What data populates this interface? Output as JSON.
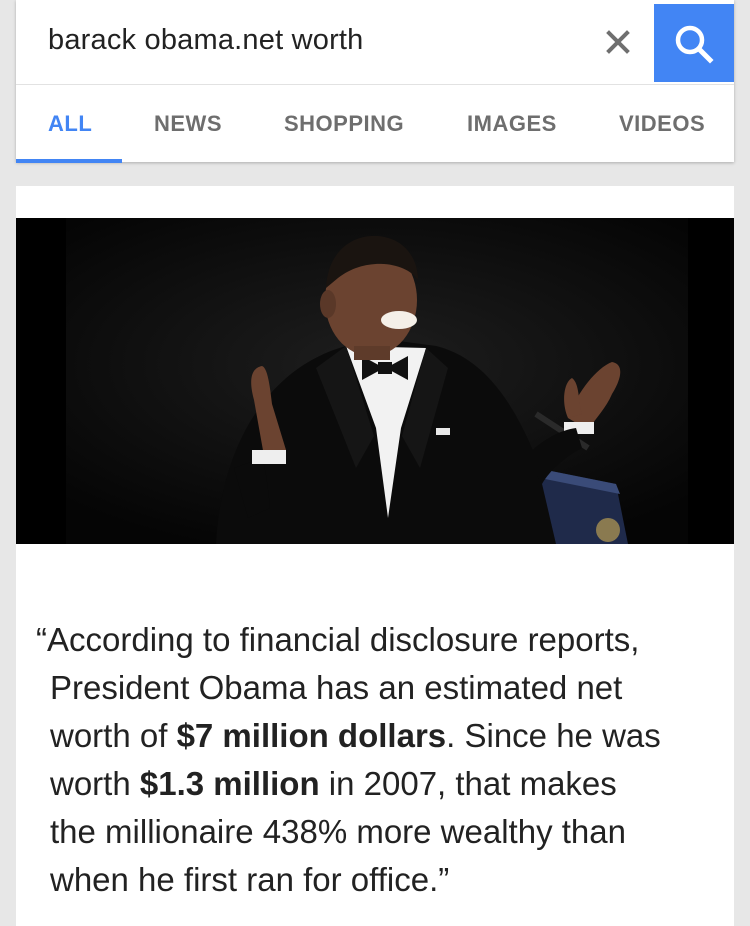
{
  "search": {
    "query": "barack obama.net worth",
    "clear_icon": "close-icon",
    "search_icon": "search-icon",
    "accent_color": "#4285f4"
  },
  "tabs": [
    {
      "label": "ALL",
      "active": true
    },
    {
      "label": "NEWS",
      "active": false
    },
    {
      "label": "SHOPPING",
      "active": false
    },
    {
      "label": "IMAGES",
      "active": false
    },
    {
      "label": "VIDEOS",
      "active": false
    }
  ],
  "result": {
    "image": "photo-of-barack-obama-smiling-at-podium",
    "quote": {
      "line1": "“According to financial disclosure reports,",
      "line2": "President Obama has an estimated net",
      "line3_pre": "worth of ",
      "line3_bold": "$7 million dollars",
      "line3_post": ". Since he was",
      "line4_pre": "worth ",
      "line4_bold": "$1.3 million",
      "line4_post": " in 2007, that makes",
      "line5": "the millionaire 438% more wealthy than",
      "line6": "when he first ran for office.”"
    }
  }
}
